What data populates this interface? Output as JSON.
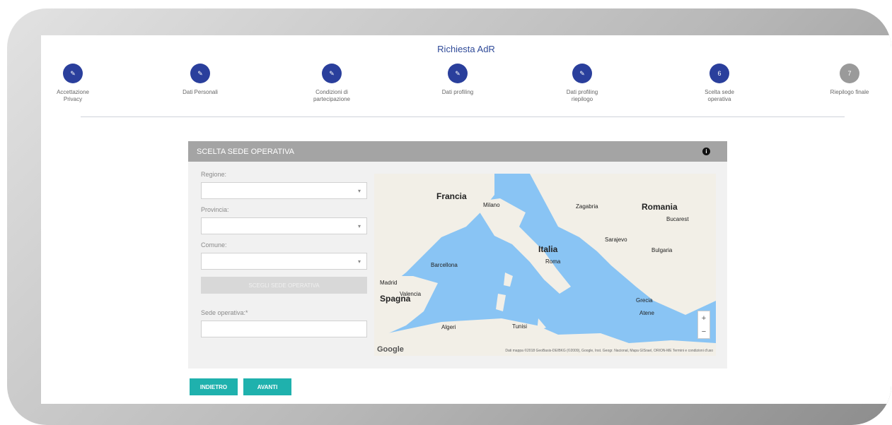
{
  "header": {
    "title": "Richiesta AdR"
  },
  "steps": [
    {
      "label": "Accettazione\nPrivacy",
      "state": "done",
      "number": ""
    },
    {
      "label": "Dati Personali",
      "state": "done",
      "number": ""
    },
    {
      "label": "Condizioni di\npartecipazione",
      "state": "done",
      "number": ""
    },
    {
      "label": "Dati profiling",
      "state": "done",
      "number": ""
    },
    {
      "label": "Dati profiling\nriepilogo",
      "state": "done",
      "number": ""
    },
    {
      "label": "Scelta sede\noperativa",
      "state": "current",
      "number": "6"
    },
    {
      "label": "Riepilogo finale",
      "state": "todo",
      "number": "7"
    }
  ],
  "panel": {
    "title": "SCELTA SEDE OPERATIVA",
    "region_label": "Regione:",
    "province_label": "Provincia:",
    "municipality_label": "Comune:",
    "choose_button": "SCEGLI SEDE OPERATIVA",
    "operational_site_label": "Sede operativa:*"
  },
  "map": {
    "google": "Google",
    "footer": "Dati mappa ©2018 GeoBasis-DE/BKG (©2009), Google, Inst. Geogr. Nacional, Mapa GISrael, ORION-ME  Termini e condizioni d'uso",
    "labels": [
      {
        "text": "Francia",
        "big": true
      },
      {
        "text": "Italia",
        "big": true
      },
      {
        "text": "Spagna",
        "big": true
      },
      {
        "text": "Romania",
        "big": true
      },
      {
        "text": "Bulgaria",
        "big": false
      },
      {
        "text": "Grecia",
        "big": false
      },
      {
        "text": "Milano",
        "big": false
      },
      {
        "text": "Roma",
        "big": false
      },
      {
        "text": "Madrid",
        "big": false
      },
      {
        "text": "Valencia",
        "big": false
      },
      {
        "text": "Barcellona",
        "big": false
      },
      {
        "text": "Algeri",
        "big": false
      },
      {
        "text": "Tunisi",
        "big": false
      },
      {
        "text": "Sarajevo",
        "big": false
      },
      {
        "text": "Bucarest",
        "big": false
      },
      {
        "text": "Atene",
        "big": false
      },
      {
        "text": "Zagabria",
        "big": false
      }
    ]
  },
  "actions": {
    "back": "INDIETRO",
    "next": "AVANTI"
  }
}
